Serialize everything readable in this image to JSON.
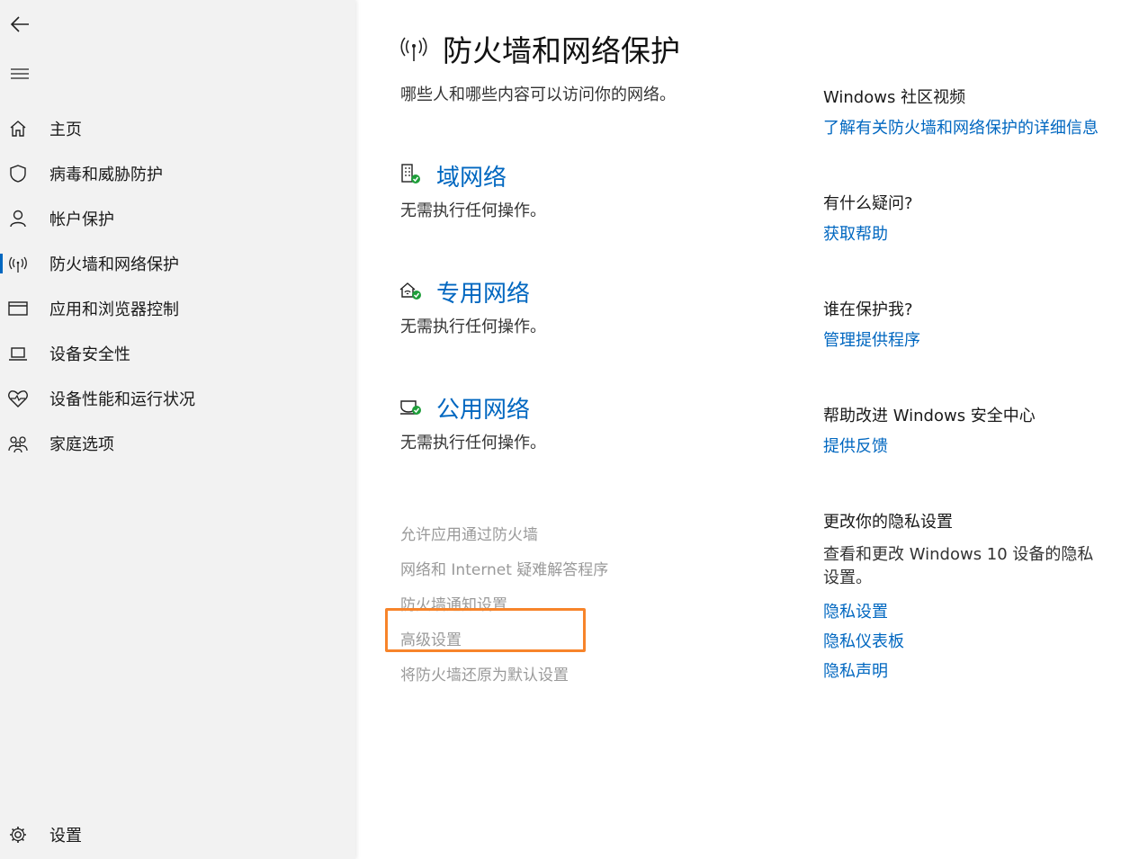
{
  "sidebar": {
    "back_icon": "back-arrow-icon",
    "menu_icon": "hamburger-icon",
    "items": [
      {
        "label": "主页",
        "icon": "home-icon"
      },
      {
        "label": "病毒和威胁防护",
        "icon": "shield-icon"
      },
      {
        "label": "帐户保护",
        "icon": "person-icon"
      },
      {
        "label": "防火墙和网络保护",
        "icon": "antenna-icon",
        "active": true
      },
      {
        "label": "应用和浏览器控制",
        "icon": "app-window-icon"
      },
      {
        "label": "设备安全性",
        "icon": "laptop-icon"
      },
      {
        "label": "设备性能和运行状况",
        "icon": "heart-pulse-icon"
      },
      {
        "label": "家庭选项",
        "icon": "family-icon"
      }
    ],
    "settings": {
      "label": "设置",
      "icon": "gear-icon"
    }
  },
  "main": {
    "title": "防火墙和网络保护",
    "subtitle": "哪些人和哪些内容可以访问你的网络。",
    "networks": [
      {
        "title": "域网络",
        "status": "无需执行任何操作。",
        "icon": "domain-network-icon"
      },
      {
        "title": "专用网络",
        "status": "无需执行任何操作。",
        "icon": "private-network-icon"
      },
      {
        "title": "公用网络",
        "status": "无需执行任何操作。",
        "icon": "public-network-icon"
      }
    ],
    "links": [
      "允许应用通过防火墙",
      "网络和 Internet 疑难解答程序",
      "防火墙通知设置",
      "高级设置",
      "将防火墙还原为默认设置"
    ]
  },
  "right": {
    "community": {
      "heading": "Windows 社区视频",
      "link": "了解有关防火墙和网络保护的详细信息"
    },
    "help": {
      "heading": "有什么疑问?",
      "link": "获取帮助"
    },
    "protect": {
      "heading": "谁在保护我?",
      "link": "管理提供程序"
    },
    "improve": {
      "heading": "帮助改进 Windows 安全中心",
      "link": "提供反馈"
    },
    "privacy": {
      "heading": "更改你的隐私设置",
      "text": "查看和更改 Windows 10 设备的隐私设置。",
      "links": [
        "隐私设置",
        "隐私仪表板",
        "隐私声明"
      ]
    }
  },
  "colors": {
    "accent": "#0067c0",
    "highlight": "#f7842a",
    "ok_badge": "#1e9e3a"
  }
}
